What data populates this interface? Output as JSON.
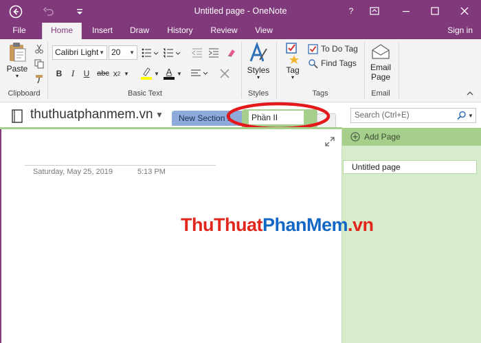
{
  "window": {
    "title": "Untitled page - OneNote",
    "help_label": "?"
  },
  "ribbon_tabs": [
    "File",
    "Home",
    "Insert",
    "Draw",
    "History",
    "Review",
    "View"
  ],
  "signin_label": "Sign in",
  "ribbon": {
    "paste_label": "Paste",
    "clipboard_group": "Clipboard",
    "font_name": "Calibri Light",
    "font_size": "20",
    "bold": "B",
    "italic": "I",
    "underline": "U",
    "strike": "abc",
    "subscript": "x",
    "subscript_sub": "2",
    "font_color": "A",
    "basic_text_group": "Basic Text",
    "styles_label": "Styles",
    "styles_group": "Styles",
    "tag_label": "Tag",
    "todo_tag_label": "To Do Tag",
    "find_tags_label": "Find Tags",
    "tags_group": "Tags",
    "email_page_line1": "Email",
    "email_page_line2": "Page",
    "email_group": "Email"
  },
  "notebook": {
    "name": "thuthuatphanmem.vn",
    "sections": [
      {
        "label": "New Section 1",
        "color": "#8eaadb"
      },
      {
        "label": "Phần II",
        "color": "#a6cf8c"
      }
    ],
    "search_placeholder": "Search (Ctrl+E)"
  },
  "page": {
    "date": "Saturday, May 25, 2019",
    "time": "5:13 PM"
  },
  "pages_pane": {
    "add_page_label": "Add Page",
    "pages": [
      "Untitled page"
    ]
  },
  "watermark": {
    "part1": "ThuThuat",
    "part2": "PhanMem",
    "part3": ".vn"
  },
  "colors": {
    "accent": "#80397b",
    "section_green": "#a6cf8c",
    "highlight_ring": "#e3191b"
  }
}
